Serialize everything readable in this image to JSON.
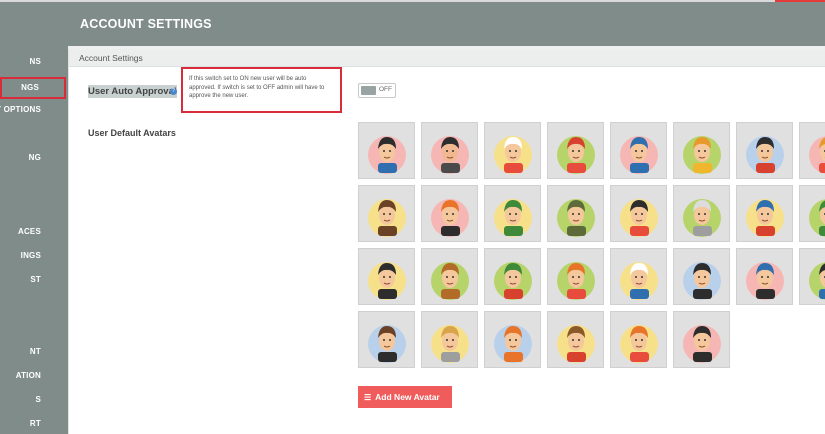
{
  "header": {
    "title": "ACCOUNT SETTINGS"
  },
  "panel": {
    "title": "Account Settings"
  },
  "sidebar": {
    "items": [
      {
        "key": "options",
        "label": "NS"
      },
      {
        "key": "settings",
        "label": "NGS",
        "active": true
      },
      {
        "key": "privacy",
        "label": "Y OPTIONS"
      },
      {
        "key": "ing",
        "label": "NG"
      },
      {
        "key": "spaces",
        "label": "ACES"
      },
      {
        "key": "settings2",
        "label": "INGS"
      },
      {
        "key": "list",
        "label": "ST"
      },
      {
        "key": "account",
        "label": "NT"
      },
      {
        "key": "translation",
        "label": "ATION"
      },
      {
        "key": "reports",
        "label": "S"
      },
      {
        "key": "export",
        "label": "RT"
      }
    ]
  },
  "approval": {
    "label": "User Auto Approval",
    "help_icon": "question-circle-icon",
    "tooltip": "If this switch set to ON new user will be auto approved. If switch is set to OFF admin will have to approve the new user.",
    "toggle_state": "OFF"
  },
  "avatars": {
    "label": "User Default Avatars",
    "items": [
      {
        "name": "man-glasses-suit",
        "circle": "#f6b6b4",
        "hair": "#2d2d2d",
        "skin": "#f5c79d",
        "accent": "#2f6fb0"
      },
      {
        "name": "bearded-man",
        "circle": "#f6b6b4",
        "hair": "#2d2d2d",
        "skin": "#f1b991",
        "accent": "#4a4a4a"
      },
      {
        "name": "chef",
        "circle": "#f7e08a",
        "hair": "#ffffff",
        "skin": "#f5c79d",
        "accent": "#e84c3d"
      },
      {
        "name": "red-cap-girl",
        "circle": "#b6d46a",
        "hair": "#d9412f",
        "skin": "#f5c79d",
        "accent": "#e84c3d"
      },
      {
        "name": "blue-cap-man",
        "circle": "#f6b6b4",
        "hair": "#2f6fb0",
        "skin": "#f5c79d",
        "accent": "#2f6fb0"
      },
      {
        "name": "king",
        "circle": "#b6d46a",
        "hair": "#e79a2b",
        "skin": "#f5c79d",
        "accent": "#f0b62d"
      },
      {
        "name": "mustache-man",
        "circle": "#b9d0ea",
        "hair": "#2d2d2d",
        "skin": "#f5c79d",
        "accent": "#d9412f"
      },
      {
        "name": "partial-avatar",
        "circle": "#f6b6b4",
        "hair": "#e79a2b",
        "skin": "#f5c79d",
        "accent": "#e84c3d"
      },
      {
        "name": "brunette-woman",
        "circle": "#f7e08a",
        "hair": "#6b4226",
        "skin": "#f5c79d",
        "accent": "#6b4226"
      },
      {
        "name": "masked-man",
        "circle": "#f6b6b4",
        "hair": "#e8742a",
        "skin": "#f5c79d",
        "accent": "#2d2d2d"
      },
      {
        "name": "green-hat-man",
        "circle": "#f7e08a",
        "hair": "#3f8a3a",
        "skin": "#f5c79d",
        "accent": "#3f8a3a"
      },
      {
        "name": "soldier",
        "circle": "#b6d46a",
        "hair": "#5d6b3a",
        "skin": "#f5c79d",
        "accent": "#5d6b3a"
      },
      {
        "name": "pirate",
        "circle": "#f7e08a",
        "hair": "#2d2d2d",
        "skin": "#f5c79d",
        "accent": "#e84c3d"
      },
      {
        "name": "scientist",
        "circle": "#b6d46a",
        "hair": "#dcdcdc",
        "skin": "#f5c79d",
        "accent": "#9e9e9e"
      },
      {
        "name": "bowtie-man",
        "circle": "#f7e08a",
        "hair": "#2f6fb0",
        "skin": "#f5c79d",
        "accent": "#d9412f"
      },
      {
        "name": "partial-avatar-2",
        "circle": "#b6d46a",
        "hair": "#3f8a3a",
        "skin": "#f5c79d",
        "accent": "#3f8a3a"
      },
      {
        "name": "police-officer",
        "circle": "#f7e08a",
        "hair": "#2d2d2d",
        "skin": "#f5c79d",
        "accent": "#2d2d2d"
      },
      {
        "name": "cowboy",
        "circle": "#b6d46a",
        "hair": "#b36b2a",
        "skin": "#f5c79d",
        "accent": "#b36b2a"
      },
      {
        "name": "old-man-cap",
        "circle": "#b6d46a",
        "hair": "#3f8a3a",
        "skin": "#f5c79d",
        "accent": "#d9412f"
      },
      {
        "name": "redhead-woman",
        "circle": "#b6d46a",
        "hair": "#e8742a",
        "skin": "#f5c79d",
        "accent": "#e84c3d"
      },
      {
        "name": "sailor",
        "circle": "#f7e08a",
        "hair": "#ffffff",
        "skin": "#f5c79d",
        "accent": "#2f6fb0"
      },
      {
        "name": "dark-hair-man",
        "circle": "#b9d0ea",
        "hair": "#2d2d2d",
        "skin": "#f5c79d",
        "accent": "#2d2d2d"
      },
      {
        "name": "cop-sunglasses",
        "circle": "#f6b6b4",
        "hair": "#2f6fb0",
        "skin": "#f5c79d",
        "accent": "#2d2d2d"
      },
      {
        "name": "partial-avatar-3",
        "circle": "#b6d46a",
        "hair": "#2d2d2d",
        "skin": "#f5c79d",
        "accent": "#2f6fb0"
      },
      {
        "name": "priest",
        "circle": "#b9d0ea",
        "hair": "#6b4226",
        "skin": "#f5c79d",
        "accent": "#2d2d2d"
      },
      {
        "name": "blond-man",
        "circle": "#f7e08a",
        "hair": "#d9a44a",
        "skin": "#f5c79d",
        "accent": "#9e9e9e"
      },
      {
        "name": "construction-worker",
        "circle": "#b9d0ea",
        "hair": "#e8742a",
        "skin": "#f5c79d",
        "accent": "#e8742a"
      },
      {
        "name": "cowboy-bandana",
        "circle": "#f7e08a",
        "hair": "#8a5a2b",
        "skin": "#f5c79d",
        "accent": "#d9412f"
      },
      {
        "name": "hipster-glasses",
        "circle": "#f7e08a",
        "hair": "#e8742a",
        "skin": "#f5c79d",
        "accent": "#e84c3d"
      },
      {
        "name": "rockabilly-man",
        "circle": "#f6b6b4",
        "hair": "#2d2d2d",
        "skin": "#f5c79d",
        "accent": "#2d2d2d"
      }
    ]
  },
  "add_button": {
    "label": "Add New Avatar",
    "icon": "list-plus-icon"
  },
  "colors": {
    "sidebar": "#7f8c8a",
    "accent_red": "#f05b5b",
    "highlight_border": "#d92c3a"
  }
}
